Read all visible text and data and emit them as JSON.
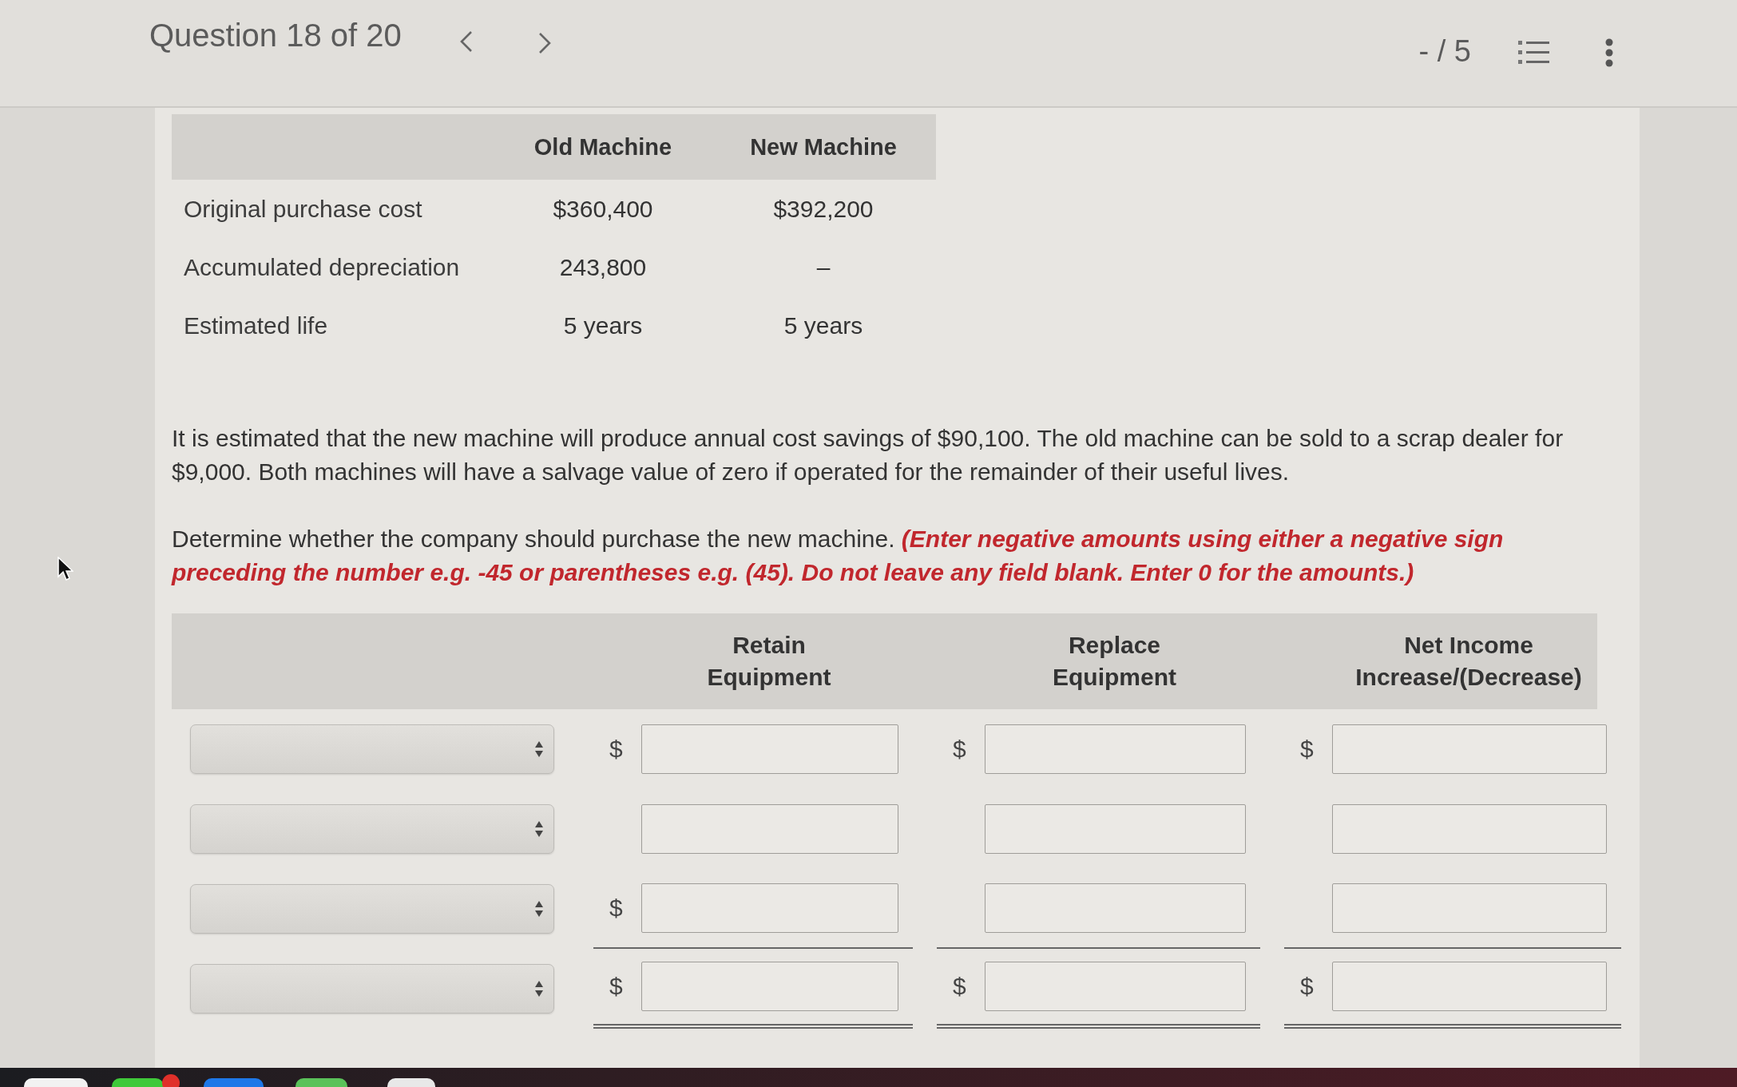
{
  "header": {
    "title": "Question 18 of 20",
    "score": "- / 5"
  },
  "machine_table": {
    "columns": [
      "Old Machine",
      "New Machine"
    ],
    "rows": [
      {
        "label": "Original purchase cost",
        "values": [
          "$360,400",
          "$392,200"
        ]
      },
      {
        "label": "Accumulated depreciation",
        "values": [
          "243,800",
          "–"
        ]
      },
      {
        "label": "Estimated life",
        "values": [
          "5 years",
          "5 years"
        ]
      }
    ]
  },
  "paragraphs": [
    "It is estimated that the new machine will produce annual cost savings of $90,100. The old machine can be sold to a scrap dealer for $9,000. Both machines will have a salvage value of zero if operated for the remainder of their useful lives.",
    "Determine whether the company should purchase the new machine. **(Enter negative amounts using either a negative sign preceding the number e.g. -45 or parentheses e.g. (45). Do not leave any field blank. Enter 0 for the amounts.)**"
  ],
  "answer_table": {
    "columns": [
      "Retain Equipment",
      "Replace Equipment",
      "Net Income Increase/(Decrease)"
    ],
    "rows": [
      {
        "cells": [
          {
            "prefix": "$"
          },
          {
            "prefix": "$"
          },
          {
            "prefix": "$"
          }
        ]
      },
      {
        "cells": [
          {},
          {},
          {}
        ]
      },
      {
        "cells": [
          {
            "prefix": "$"
          },
          {},
          {}
        ],
        "single_underline": true
      },
      {
        "cells": [
          {
            "prefix": "$"
          },
          {
            "prefix": "$"
          },
          {
            "prefix": "$"
          }
        ],
        "double_underline": true
      }
    ]
  }
}
